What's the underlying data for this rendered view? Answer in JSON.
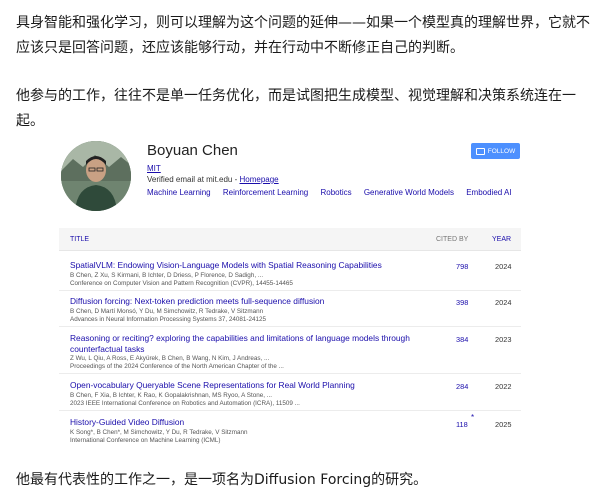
{
  "article": {
    "para1": "具身智能和强化学习，则可以理解为这个问题的延伸——如果一个模型真的理解世界，它就不应该只是回答问题，还应该能够行动，并在行动中不断修正自己的判断。",
    "para2": "他参与的工作，往往不是单一任务优化，而是试图把生成模型、视觉理解和决策系统连在一起。",
    "para3": "他最有代表性的工作之一，是一项名为Diffusion Forcing的研究。"
  },
  "profile": {
    "name": "Boyuan Chen",
    "affiliation": "MIT",
    "email_text": "Verified email at mit.edu - ",
    "homepage_label": "Homepage",
    "follow_label": "FOLLOW",
    "interests": [
      "Machine Learning",
      "Reinforcement Learning",
      "Robotics",
      "Generative World Models",
      "Embodied AI"
    ]
  },
  "table": {
    "title_header": "TITLE",
    "cited_header": "CITED BY",
    "year_header": "YEAR",
    "rows": [
      {
        "title": "SpatialVLM: Endowing Vision-Language Models with Spatial Reasoning Capabilities",
        "authors": "B Chen, Z Xu, S Kirmani, B Ichter, D Driess, P Florence, D Sadigh, ...",
        "venue": "Conference on Computer Vision and Pattern Recognition (CVPR), 14455-14465",
        "cited": "798",
        "year": "2024"
      },
      {
        "title": "Diffusion forcing: Next-token prediction meets full-sequence diffusion",
        "authors": "B Chen, D Martí Monsó, Y Du, M Simchowitz, R Tedrake, V Sitzmann",
        "venue": "Advances in Neural Information Processing Systems 37, 24081-24125",
        "cited": "398",
        "year": "2024"
      },
      {
        "title": "Reasoning or reciting? exploring the capabilities and limitations of language models through counterfactual tasks",
        "authors": "Z Wu, L Qiu, A Ross, E Akyürek, B Chen, B Wang, N Kim, J Andreas, ...",
        "venue": "Proceedings of the 2024 Conference of the North American Chapter of the ...",
        "cited": "384",
        "year": "2023"
      },
      {
        "title": "Open-vocabulary Queryable Scene Representations for Real World Planning",
        "authors": "B Chen, F Xia, B Ichter, K Rao, K Gopalakrishnan, MS Ryoo, A Stone, ...",
        "venue": "2023 IEEE International Conference on Robotics and Automation (ICRA), 11509 ...",
        "cited": "284",
        "year": "2022"
      },
      {
        "title": "History-Guided Video Diffusion",
        "authors": "K Song*, B Chen*, M Simchowitz, Y Du, R Tedrake, V Sitzmann",
        "venue": "International Conference on Machine Learning (ICML)",
        "cited": "118",
        "star": "*",
        "year": "2025"
      }
    ]
  }
}
